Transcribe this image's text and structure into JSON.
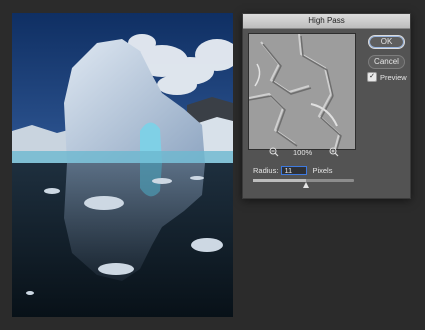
{
  "dialog": {
    "title": "High Pass",
    "ok_label": "OK",
    "cancel_label": "Cancel",
    "preview_label": "Preview",
    "preview_checked": true,
    "zoom_out_icon": "zoom-out-icon",
    "zoom_in_icon": "zoom-in-icon",
    "zoom_level": "100%",
    "radius_label": "Radius:",
    "radius_value": "11",
    "radius_unit": "Pixels",
    "slider_fraction": 0.52
  },
  "canvas": {
    "subject": "iceberg-photo"
  }
}
